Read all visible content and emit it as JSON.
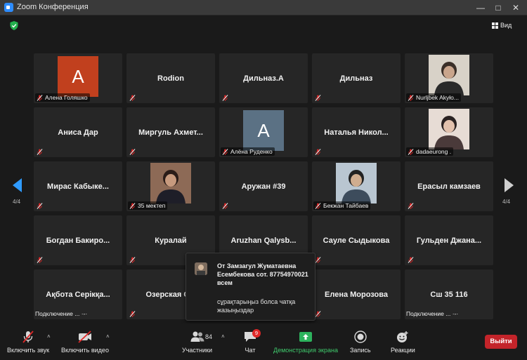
{
  "window": {
    "title": "Zoom Конференция"
  },
  "view": {
    "label": "Вид"
  },
  "pager": {
    "left": "4/4",
    "right": "4/4"
  },
  "tiles": [
    {
      "name": "",
      "caption": "Алена Голяшко",
      "avatar": "A",
      "color": "#c1401e"
    },
    {
      "name": "Rodion",
      "caption": ""
    },
    {
      "name": "Дильназ.А",
      "caption": ""
    },
    {
      "name": "Дильназ",
      "caption": ""
    },
    {
      "name": "",
      "caption": "Nurljbek Akyło...",
      "photo": true
    },
    {
      "name": "Аниса Дар",
      "caption": ""
    },
    {
      "name": "Миргуль Ахмет...",
      "caption": ""
    },
    {
      "name": "",
      "caption": "Алёна Руденко",
      "avatar": "A",
      "color": "#5b7184"
    },
    {
      "name": "Наталья Никол...",
      "caption": ""
    },
    {
      "name": "",
      "caption": "dadaeurong .",
      "photo": true
    },
    {
      "name": "Мирас Кабыке...",
      "caption": ""
    },
    {
      "name": "",
      "caption": "35 мектеп",
      "photo": true
    },
    {
      "name": "Аружан #39",
      "caption": ""
    },
    {
      "name": "",
      "caption": "Бекжан Тайбаев",
      "photo": true
    },
    {
      "name": "Ерасыл камзаев",
      "caption": ""
    },
    {
      "name": "Богдан Бакиро...",
      "caption": ""
    },
    {
      "name": "Куралай",
      "caption": ""
    },
    {
      "name": "Aruzhan Qalysb...",
      "caption": ""
    },
    {
      "name": "Сауле Сыдыкова",
      "caption": ""
    },
    {
      "name": "Гульден Джана...",
      "caption": ""
    },
    {
      "name": "Ақбота Серікқа...",
      "caption": "",
      "connecting": "Подключение ... ·-·"
    },
    {
      "name": "Озерская С...",
      "caption": ""
    },
    {
      "name": "",
      "caption": ""
    },
    {
      "name": "Елена Морозова",
      "caption": ""
    },
    {
      "name": "Сш 35 116",
      "caption": "",
      "connecting": "Подключение ... ·-·"
    }
  ],
  "chat_popup": {
    "from": "От Замзагул Жуматаевна Есембекова  сот. 87754970021 всем",
    "message": "сұрақтарыңыз болса чатқа жазыңыздар"
  },
  "toolbar": {
    "audio": "Включить звук",
    "video": "Включить видео",
    "participants": "Участники",
    "participants_count": "84",
    "chat": "Чат",
    "chat_badge": "9",
    "share": "Демонстрация экрана",
    "record": "Запись",
    "reactions": "Реакции",
    "leave": "Выйти"
  }
}
